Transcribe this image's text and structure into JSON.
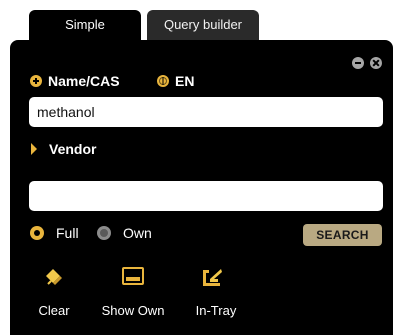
{
  "tabs": [
    {
      "label": "Simple",
      "active": true
    },
    {
      "label": "Query builder",
      "active": false
    }
  ],
  "window_controls": {
    "minimize_icon": "minus-circle-icon",
    "close_icon": "close-circle-icon"
  },
  "search": {
    "name_label": "Name/CAS",
    "language_label": "EN",
    "name_value": "methanol",
    "vendor_label": "Vendor",
    "vendor_value": ""
  },
  "scope": {
    "options": [
      {
        "label": "Full",
        "selected": true
      },
      {
        "label": "Own",
        "selected": false
      }
    ]
  },
  "search_button_label": "SEARCH",
  "tools": [
    {
      "label": "Clear",
      "icon": "eraser-icon"
    },
    {
      "label": "Show Own",
      "icon": "folder-icon"
    },
    {
      "label": "In-Tray",
      "icon": "tray-arrow-icon"
    }
  ],
  "colors": {
    "accent": "#e9b53d",
    "panel_background": "#000000",
    "search_button": "#b9a982"
  }
}
